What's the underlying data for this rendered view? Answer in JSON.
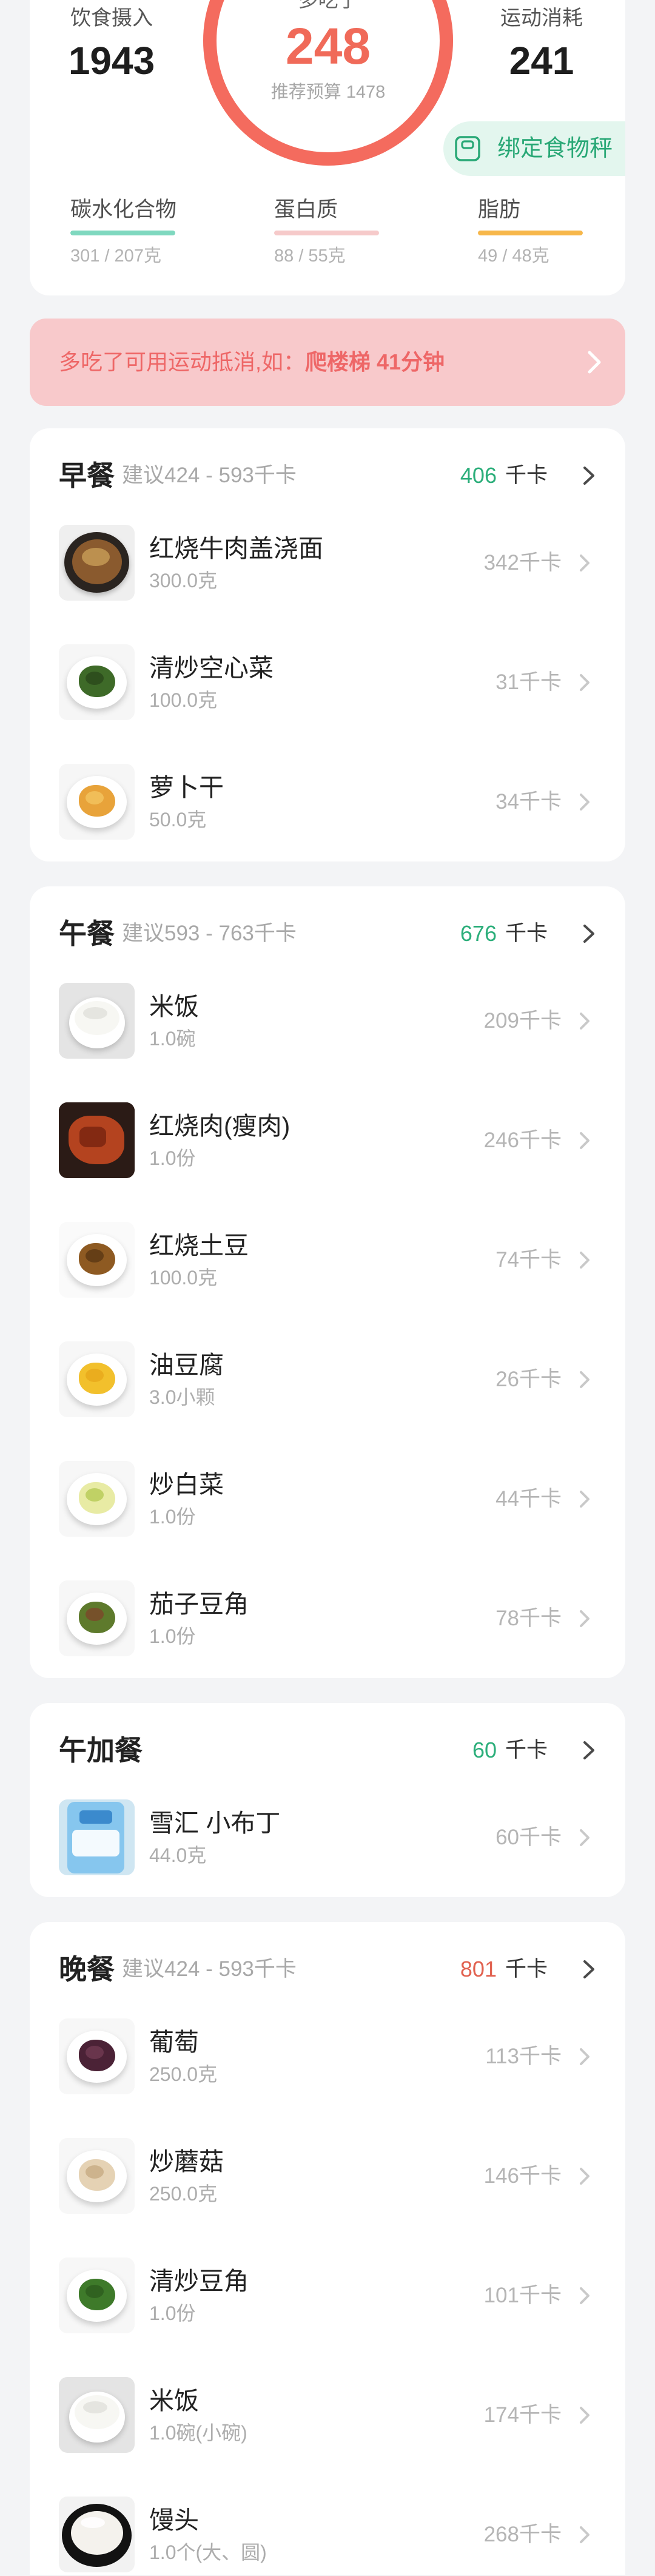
{
  "summary": {
    "intake": {
      "label": "饮食摄入",
      "value": "1943"
    },
    "over": {
      "label": "多吃了",
      "value": "248",
      "budget": "推荐预算 1478",
      "ring_progress": 1.0,
      "ring_color": "#F46B5E"
    },
    "burn": {
      "label": "运动消耗",
      "value": "241"
    },
    "bind_scale": {
      "label": "绑定食物秤",
      "icon": "scale-icon",
      "color": "#29A876"
    },
    "macros": [
      {
        "label": "碳水化合物",
        "value": "301 / 207克",
        "progress": 1.0,
        "color": "#7FD8BF"
      },
      {
        "label": "蛋白质",
        "value": "88 / 55克",
        "progress": 1.0,
        "color": "#F6CACA"
      },
      {
        "label": "脂肪",
        "value": "49 / 48克",
        "progress": 1.0,
        "color": "#F7B74A"
      }
    ]
  },
  "banner": {
    "text": "多吃了可用运动抵消,如：",
    "highlight": "爬楼梯 41分钟",
    "color": "#EE6767",
    "background": "#F8C9CB",
    "icon": "chevron-right-icon"
  },
  "meals": [
    {
      "title": "早餐",
      "suggestion": "建议424 - 593千卡",
      "value": "406",
      "unit": "千卡",
      "value_color": "#2BAE7A",
      "items": [
        {
          "name": "红烧牛肉盖浇面",
          "amount": "300.0克",
          "kcal": "342千卡",
          "image": {
            "kind": "dark-bowl",
            "bg": "#EFEFEF",
            "food": "#8A5A2E",
            "accent": "#C49A55"
          }
        },
        {
          "name": "清炒空心菜",
          "amount": "100.0克",
          "kcal": "31千卡",
          "image": {
            "kind": "plate",
            "bg": "#F6F6F6",
            "food": "#3E6A28",
            "accent": "#2B4A1B"
          }
        },
        {
          "name": "萝卜干",
          "amount": "50.0克",
          "kcal": "34千卡",
          "image": {
            "kind": "plate",
            "bg": "#F6F6F6",
            "food": "#E8A33A",
            "accent": "#F2C35E"
          }
        }
      ]
    },
    {
      "title": "午餐",
      "suggestion": "建议593 - 763千卡",
      "value": "676",
      "unit": "千卡",
      "value_color": "#2BAE7A",
      "items": [
        {
          "name": "米饭",
          "amount": "1.0碗",
          "kcal": "209千卡",
          "image": {
            "kind": "rice-bowl",
            "bg": "#E4E4E4",
            "food": "#F7F7F3",
            "accent": "#E2E2DC"
          }
        },
        {
          "name": "红烧肉(瘦肉)",
          "amount": "1.0份",
          "kcal": "246千卡",
          "image": {
            "kind": "dark-plate",
            "bg": "#3A2A24",
            "food": "#B4431F",
            "accent": "#7A2410"
          }
        },
        {
          "name": "红烧土豆",
          "amount": "100.0克",
          "kcal": "74千卡",
          "image": {
            "kind": "plate",
            "bg": "#FAFAFA",
            "food": "#8E5A22",
            "accent": "#5E3A14"
          }
        },
        {
          "name": "油豆腐",
          "amount": "3.0小颗",
          "kcal": "26千卡",
          "image": {
            "kind": "plate",
            "bg": "#F7F7F7",
            "food": "#F2C02C",
            "accent": "#E9A91C"
          }
        },
        {
          "name": "炒白菜",
          "amount": "1.0份",
          "kcal": "44千卡",
          "image": {
            "kind": "plate",
            "bg": "#F7F7F7",
            "food": "#E8EBA4",
            "accent": "#B9CC5A"
          }
        },
        {
          "name": "茄子豆角",
          "amount": "1.0份",
          "kcal": "78千卡",
          "image": {
            "kind": "plate",
            "bg": "#F7F7F7",
            "food": "#5E7A2C",
            "accent": "#7A4A2A"
          }
        }
      ]
    },
    {
      "title": "午加餐",
      "value": "60",
      "unit": "千卡",
      "value_color": "#2BAE7A",
      "items": [
        {
          "name": "雪汇 小布丁",
          "amount": "44.0克",
          "kcal": "60千卡",
          "image": {
            "kind": "package",
            "bg": "#CFE6F2",
            "food": "#F4FAFE",
            "accent": "#2E7FC7"
          }
        }
      ]
    },
    {
      "title": "晚餐",
      "suggestion": "建议424 - 593千卡",
      "value": "801",
      "unit": "千卡",
      "value_color": "#E1604E",
      "items": [
        {
          "name": "葡萄",
          "amount": "250.0克",
          "kcal": "113千卡",
          "image": {
            "kind": "plate",
            "bg": "#F7F7F7",
            "food": "#4B2236",
            "accent": "#6E3850"
          }
        },
        {
          "name": "炒蘑菇",
          "amount": "250.0克",
          "kcal": "146千卡",
          "image": {
            "kind": "plate",
            "bg": "#F7F7F7",
            "food": "#E5D2B4",
            "accent": "#C9AE86"
          }
        },
        {
          "name": "清炒豆角",
          "amount": "1.0份",
          "kcal": "101千卡",
          "image": {
            "kind": "plate",
            "bg": "#F7F7F7",
            "food": "#3E7A2A",
            "accent": "#2E5E1E"
          }
        },
        {
          "name": "米饭",
          "amount": "1.0碗(小碗)",
          "kcal": "174千卡",
          "image": {
            "kind": "rice-bowl",
            "bg": "#E4E4E4",
            "food": "#F7F7F3",
            "accent": "#E2E2DC"
          }
        },
        {
          "name": "馒头",
          "amount": "1.0个(大、圆)",
          "kcal": "268千卡",
          "image": {
            "kind": "bun-plate",
            "bg": "#F2F2F2",
            "food": "#F4F2ED",
            "accent": "#FFFFFF"
          }
        }
      ]
    }
  ]
}
